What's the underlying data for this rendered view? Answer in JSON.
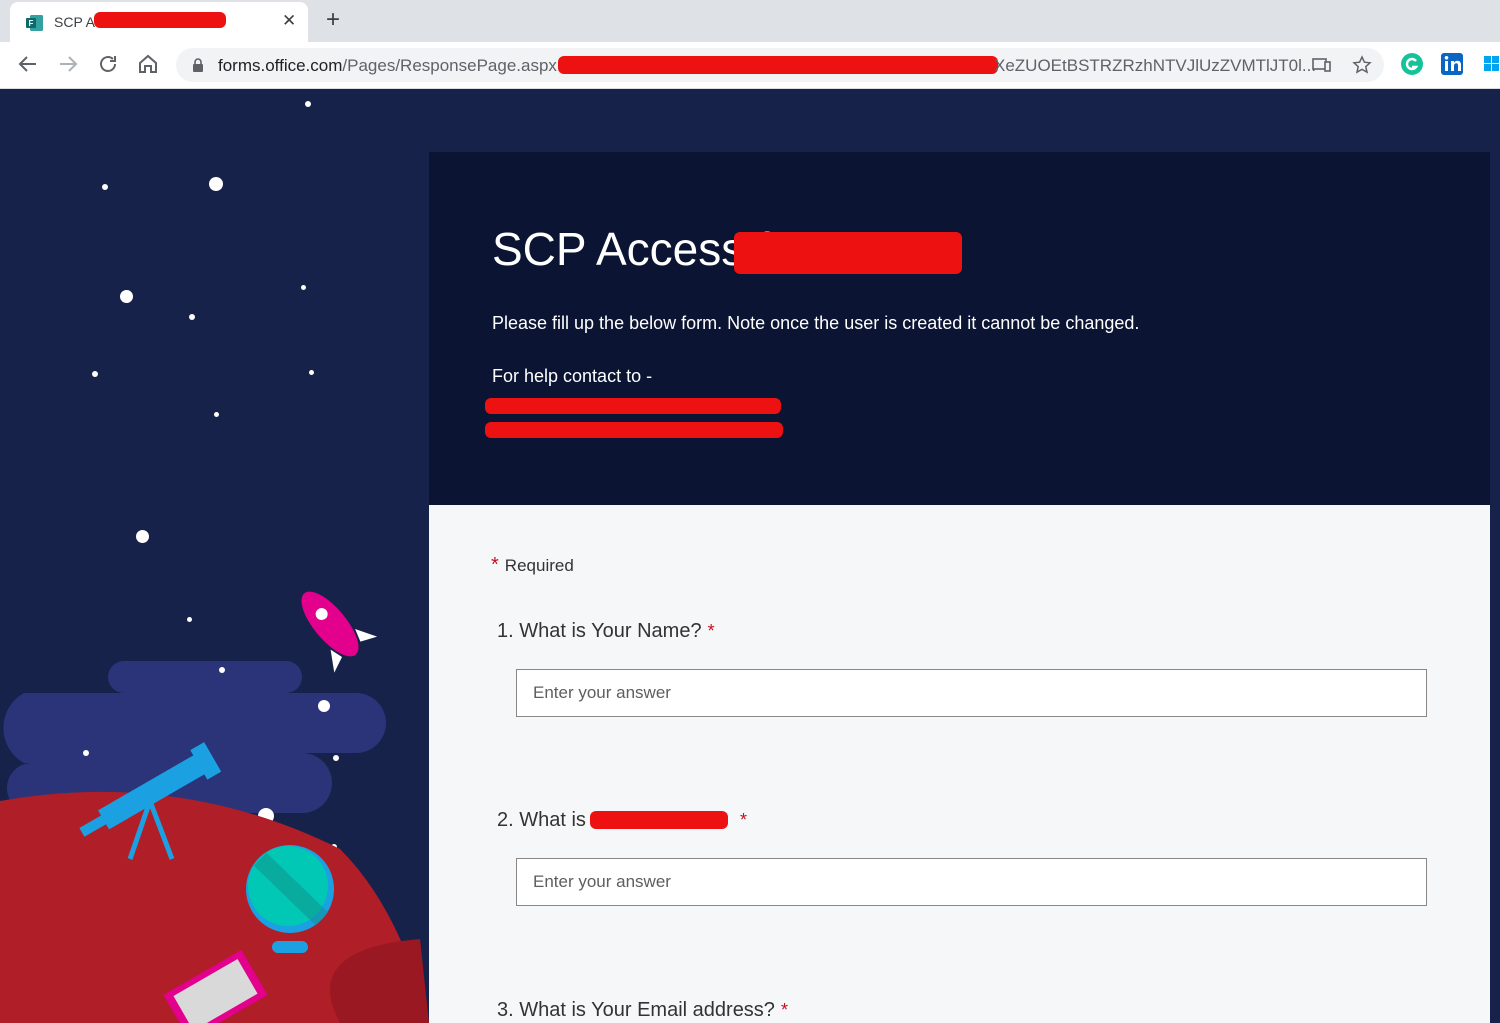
{
  "browser": {
    "tab_title": "SCP Access",
    "new_tab_label": "+",
    "close_label": "✕",
    "url_host": "forms.office.com",
    "url_path": "/Pages/ResponsePage.aspx",
    "url_tail": "XeZUOEtBSTRZRzhNTVJlUzZVMTlJT0l..."
  },
  "form": {
    "title": "SCP Access for",
    "description": "Please fill up the below form. Note once the user is created it cannot be changed.",
    "help_text": "For help contact to -",
    "required_label": "Required",
    "required_marker": "*",
    "questions": [
      {
        "number": "1.",
        "text": "What is Your Name?",
        "marker": "*",
        "placeholder": "Enter your answer"
      },
      {
        "number": "2.",
        "text": "What is",
        "marker": "*",
        "placeholder": "Enter your answer"
      },
      {
        "number": "3.",
        "text": "What is Your Email address?",
        "marker": "*"
      }
    ]
  },
  "colors": {
    "page_bg": "#17224b",
    "header_bg": "#0b1432",
    "required": "#c50f1f",
    "redaction": "#ee1111"
  }
}
